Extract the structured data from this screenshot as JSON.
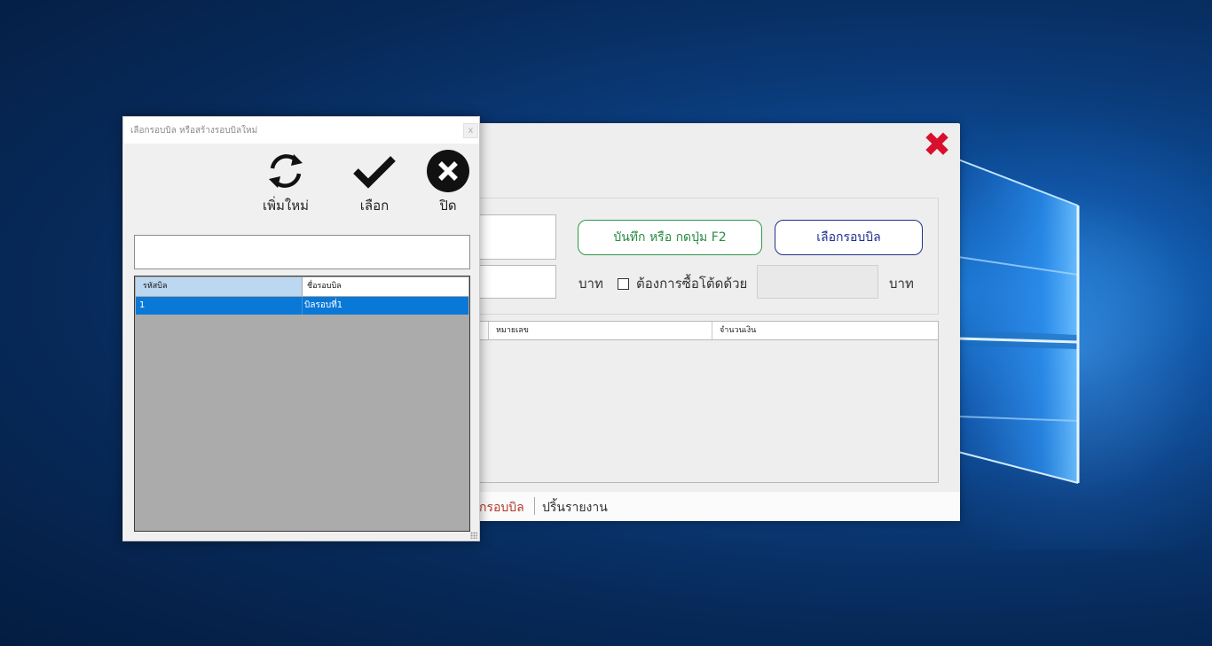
{
  "main_window": {
    "save_button": "บันทึก หรือ กดปุ่ม F2",
    "select_bill_button": "เลือกรอบบิล",
    "baht_label_1": "บาท",
    "checkbox_label": "ต้องการซื้อโต้ดด้วย",
    "checkbox_checked": false,
    "baht_label_2": "บาท",
    "grid_columns": [
      "หมายเลข",
      "จำนวนเงิน"
    ],
    "tabs": [
      "กรอบบิล",
      "ปริ้นรายงาน"
    ]
  },
  "dialog": {
    "title": "เลือกรอบบิล หรือสร้างรอบบิลใหม่",
    "close_label": "x",
    "toolbar": {
      "add_new_label": "เพิ่มใหม่",
      "select_label": "เลือก",
      "close_label": "ปิด"
    },
    "search_value": "",
    "grid": {
      "columns": [
        "รหัสบิล",
        "ชื่อรอบบิล"
      ],
      "rows": [
        {
          "id": "1",
          "name": "บิลรอบที่1",
          "selected": true
        }
      ]
    }
  },
  "colors": {
    "desktop": "#0a3a78",
    "close_red": "#d8102e",
    "selection_blue": "#0a78d7",
    "save_green": "#2e9a4a",
    "select_navy": "#1f2f8f"
  },
  "icons": [
    "close-x-icon",
    "refresh-icon",
    "checkmark-icon",
    "close-circle-icon"
  ]
}
